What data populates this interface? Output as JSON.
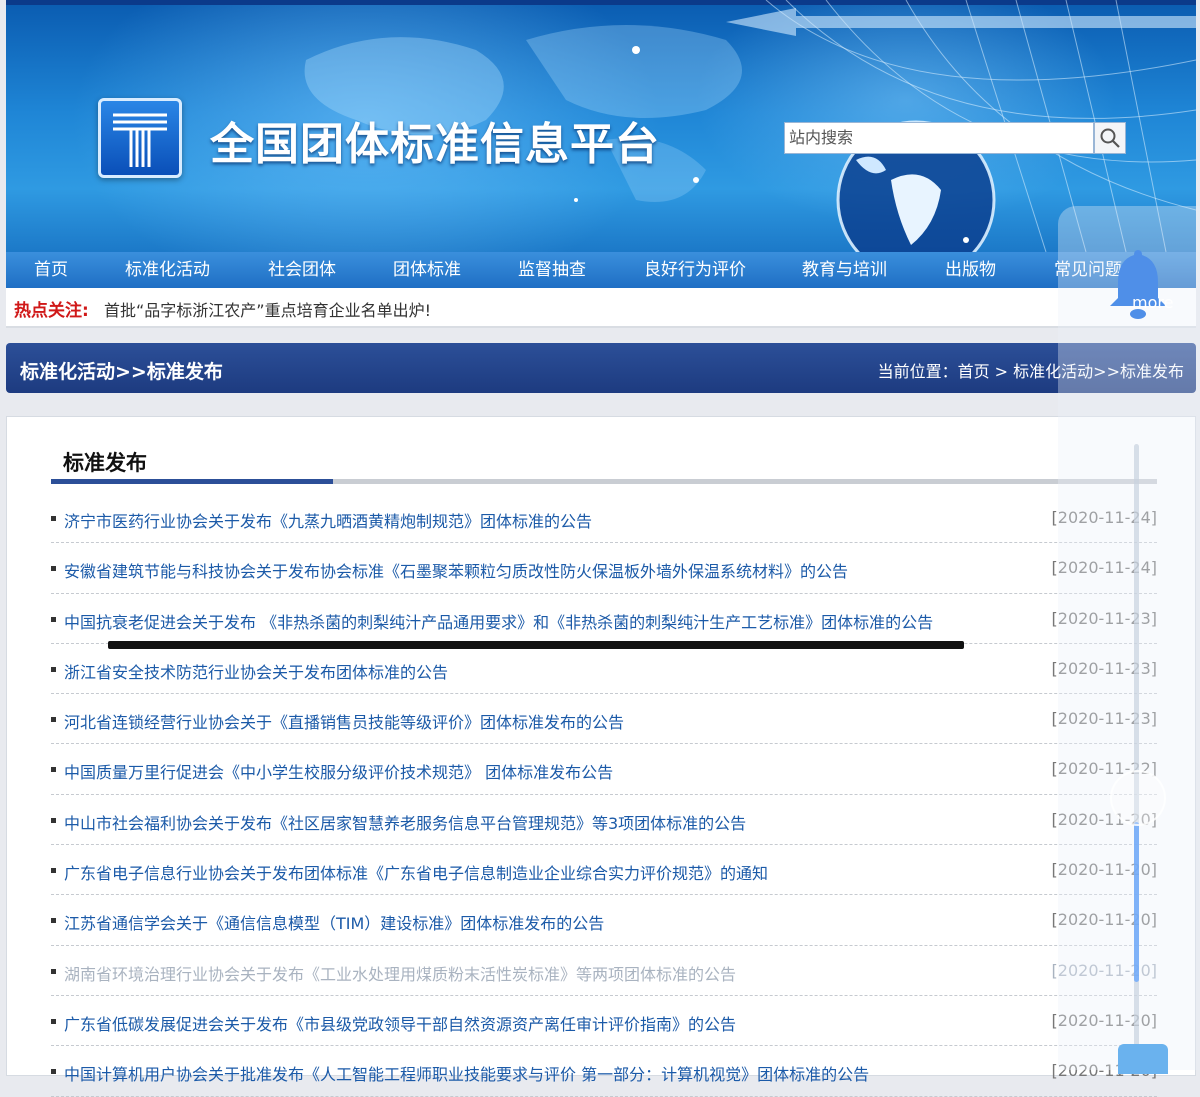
{
  "header": {
    "site_title": "全国团体标准信息平台",
    "search_placeholder": "站内搜索",
    "logo_icon": "t-standard-logo-icon",
    "search_icon": "search-icon"
  },
  "nav": {
    "items": [
      {
        "label": "首页"
      },
      {
        "label": "标准化活动"
      },
      {
        "label": "社会团体"
      },
      {
        "label": "团体标准"
      },
      {
        "label": "监督抽查"
      },
      {
        "label": "良好行为评价"
      },
      {
        "label": "教育与培训"
      },
      {
        "label": "出版物"
      },
      {
        "label": "常见问题"
      }
    ]
  },
  "hot": {
    "label": "热点关注:",
    "text": "首批“品字标浙江农产”重点培育企业名单出炉!"
  },
  "section": {
    "title": "标准化活动>>标准发布",
    "breadcrumb": "当前位置：首页 > 标准化活动>>标准发布"
  },
  "panel": {
    "title": "标准发布",
    "items": [
      {
        "title": "济宁市医药行业协会关于发布《九蒸九晒酒黄精炮制规范》团体标准的公告",
        "date": "[2020-11-24]"
      },
      {
        "title": "安徽省建筑节能与科技协会关于发布协会标准《石墨聚苯颗粒匀质改性防火保温板外墙外保温系统材料》的公告",
        "date": "[2020-11-24]"
      },
      {
        "title": "中国抗衰老促进会关于发布 《非热杀菌的刺梨纯汁产品通用要求》和《非热杀菌的刺梨纯汁生产工艺标准》团体标准的公告",
        "date": "[2020-11-23]"
      },
      {
        "title": "浙江省安全技术防范行业协会关于发布团体标准的公告",
        "date": "[2020-11-23]"
      },
      {
        "title": "河北省连锁经营行业协会关于《直播销售员技能等级评价》团体标准发布的公告",
        "date": "[2020-11-23]"
      },
      {
        "title": "中国质量万里行促进会《中小学生校服分级评价技术规范》 团体标准发布公告",
        "date": "[2020-11-22]"
      },
      {
        "title": "中山市社会福利协会关于发布《社区居家智慧养老服务信息平台管理规范》等3项团体标准的公告",
        "date": "[2020-11-20]"
      },
      {
        "title": "广东省电子信息行业协会关于发布团体标准《广东省电子信息制造业企业综合实力评价规范》的通知",
        "date": "[2020-11-20]"
      },
      {
        "title": "江苏省通信学会关于《通信信息模型（TIM）建设标准》团体标准发布的公告",
        "date": "[2020-11-20]"
      },
      {
        "title": "湖南省环境治理行业协会关于发布《工业水处理用煤质粉末活性炭标准》等两项团体标准的公告",
        "date": "[2020-11-20]"
      },
      {
        "title": "广东省低碳发展促进会关于发布《市县级党政领导干部自然资源资产离任审计评价指南》的公告",
        "date": "[2020-11-20]"
      },
      {
        "title": "中国计算机用户协会关于批准发布《人工智能工程师职业技能要求与评价 第一部分：计算机视觉》团体标准的公告",
        "date": "[2020-11-20]"
      }
    ]
  },
  "overlay": {
    "more_label": "more",
    "bell_icon": "bell-icon"
  },
  "colors": {
    "accent": "#2c4f98",
    "link": "#1b5aa8",
    "hot": "#d01818"
  }
}
